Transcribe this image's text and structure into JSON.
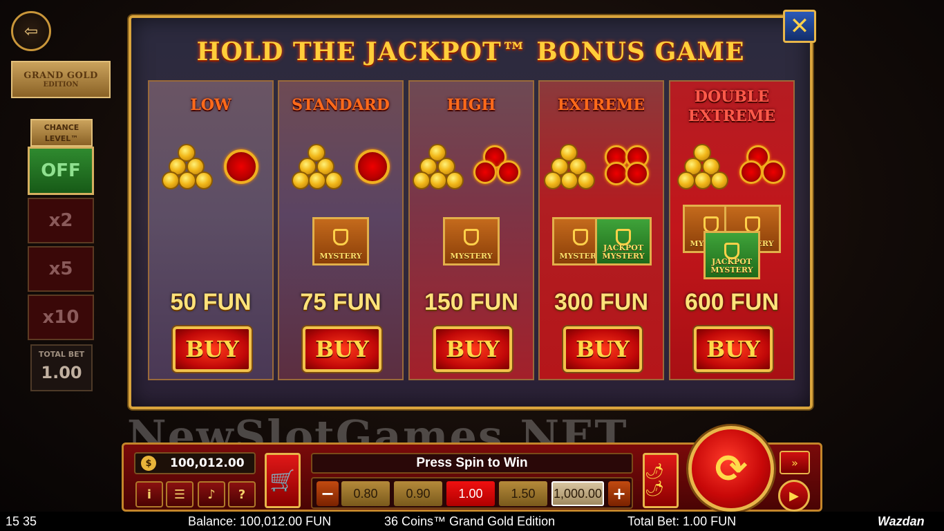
{
  "game": {
    "logo_line1": "GRAND GOLD",
    "logo_line2": "EDITION",
    "chance_level_title": "CHANCE LEVEL™",
    "chance_options": [
      "OFF",
      "x2",
      "x5",
      "x10"
    ],
    "total_bet_label": "TOTAL BET",
    "total_bet_value": "1.00"
  },
  "modal": {
    "title": "HOLD THE JACKPOT™ BONUS GAME",
    "close_icon": "close-x-icon",
    "cards": [
      {
        "name": "LOW",
        "price": "50 FUN",
        "buy": "BUY",
        "mystery_chests": [],
        "jackpot_chests": []
      },
      {
        "name": "STANDARD",
        "price": "75 FUN",
        "buy": "BUY",
        "mystery_chests": [
          "MYSTERY"
        ],
        "jackpot_chests": []
      },
      {
        "name": "HIGH",
        "price": "150 FUN",
        "buy": "BUY",
        "mystery_chests": [
          "MYSTERY"
        ],
        "jackpot_chests": []
      },
      {
        "name": "EXTREME",
        "price": "300 FUN",
        "buy": "BUY",
        "mystery_chests": [
          "MYSTERY"
        ],
        "jackpot_chests": [
          "JACKPOT MYSTERY"
        ]
      },
      {
        "name": "DOUBLE EXTREME",
        "price": "600 FUN",
        "buy": "BUY",
        "mystery_chests": [
          "MYSTERY",
          "MYSTERY"
        ],
        "jackpot_chests": [
          "JACKPOT MYSTERY"
        ]
      }
    ]
  },
  "watermark": "NewSlotGames.NET",
  "panel": {
    "balance": "100,012.00",
    "message": "Press Spin to Win",
    "bet_options": [
      "0.80",
      "0.90",
      "1.00",
      "1.50",
      "1,000.00"
    ],
    "selected_bet": "1.00",
    "minus": "−",
    "plus": "+",
    "icons": [
      "info-icon",
      "menu-icon",
      "sound-icon",
      "help-icon",
      "cart-icon",
      "chili-icon",
      "spin-icon",
      "turbo-icon",
      "autoplay-icon"
    ]
  },
  "status_bar": {
    "time": "15 35",
    "balance": "Balance: 100,012.00 FUN",
    "title": "36 Coins™ Grand Gold Edition",
    "total_bet": "Total Bet: 1.00 FUN",
    "brand": "Wazdan"
  },
  "colors": {
    "gold": "#d9a43c",
    "title_yellow": "#ffce3a",
    "buy_red": "#c10808",
    "card_orange_title": "#ff6a1a"
  }
}
